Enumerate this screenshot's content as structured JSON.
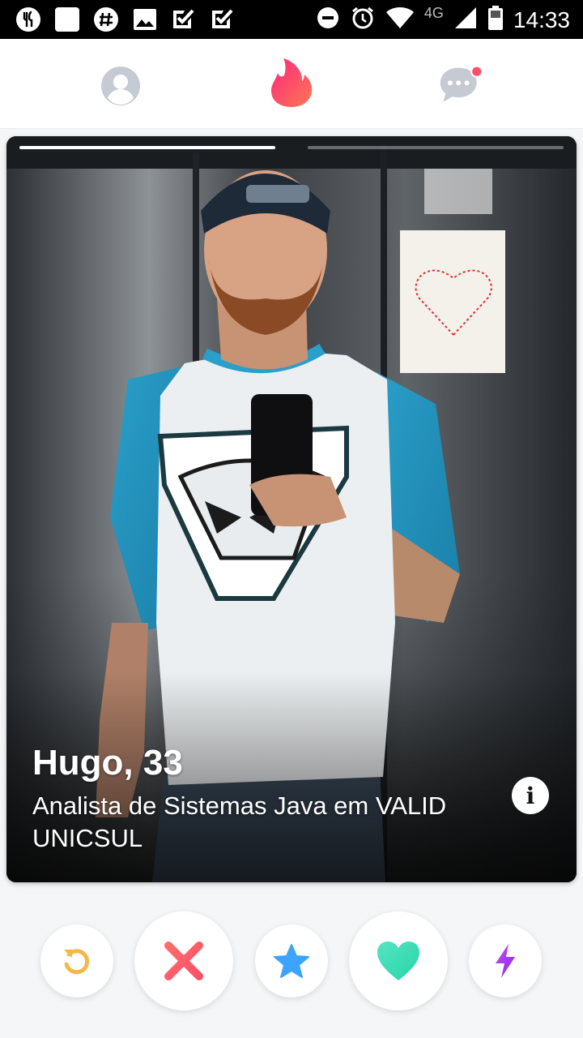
{
  "status_bar": {
    "time": "14:33",
    "network": "4G",
    "left_icons": [
      "ifood-icon",
      "blank-notification-icon",
      "slack-icon",
      "image-icon",
      "check-notification-icon",
      "check-notification-icon"
    ],
    "right_icons": [
      "do-not-disturb-icon",
      "alarm-icon",
      "wifi-icon",
      "signal-icon",
      "battery-icon"
    ]
  },
  "nav": {
    "items": [
      "profile-icon",
      "tinder-flame-icon",
      "chat-icon"
    ],
    "chat_has_notification": true,
    "accent": "#fd5068"
  },
  "card": {
    "name_age": "Hugo, 33",
    "job": "Analista de Sistemas Java em VALID UNICSUL",
    "photo_count": 2,
    "active_photo": 1
  },
  "actions": [
    {
      "name": "rewind-button",
      "icon": "rewind-icon",
      "color": "#f5b748"
    },
    {
      "name": "nope-button",
      "icon": "x-icon",
      "color": "#fd5068"
    },
    {
      "name": "super-like-button",
      "icon": "star-icon",
      "color": "#3ca4ff"
    },
    {
      "name": "like-button",
      "icon": "heart-icon",
      "color": "#3fe0b9"
    },
    {
      "name": "boost-button",
      "icon": "lightning-icon",
      "color": "#a23fff"
    }
  ]
}
